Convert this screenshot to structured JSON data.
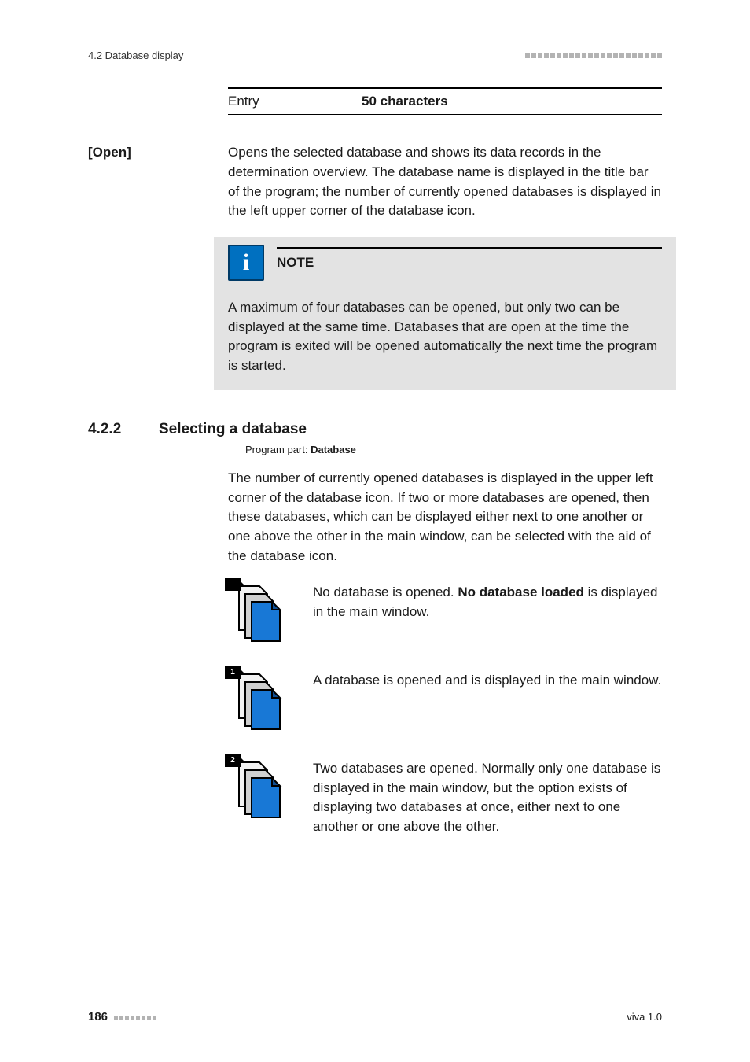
{
  "header": {
    "section_ref": "4.2 Database display"
  },
  "entry_table": {
    "label": "Entry",
    "value": "50 characters"
  },
  "open": {
    "label": "[Open]",
    "body": "Opens the selected database and shows its data records in the determination overview. The database name is displayed in the title bar of the program; the number of currently opened databases is displayed in the left upper corner of the database icon."
  },
  "note": {
    "title": "NOTE",
    "body": "A maximum of four databases can be opened, but only two can be displayed at the same time. Databases that are open at the time the program is exited will be opened automatically the next time the program is started."
  },
  "section": {
    "number": "4.2.2",
    "title": "Selecting a database",
    "program_part_prefix": "Program part: ",
    "program_part_value": "Database",
    "body": "The number of currently opened databases is displayed in the upper left corner of the database icon. If two or more databases are opened, then these databases, which can be displayed either next to one another or one above the other in the main window, can be selected with the aid of the database icon."
  },
  "icon_states": [
    {
      "badge": "",
      "text_pre": "No database is opened. ",
      "text_bold": "No database loaded",
      "text_post": " is displayed in the main window."
    },
    {
      "badge": "1",
      "text_pre": "A database is opened and is displayed in the main window.",
      "text_bold": "",
      "text_post": ""
    },
    {
      "badge": "2",
      "text_pre": "Two databases are opened. Normally only one database is displayed in the main window, but the option exists of displaying two databases at once, either next to one another or one above the other.",
      "text_bold": "",
      "text_post": ""
    }
  ],
  "footer": {
    "page": "186",
    "doc": "viva 1.0"
  }
}
